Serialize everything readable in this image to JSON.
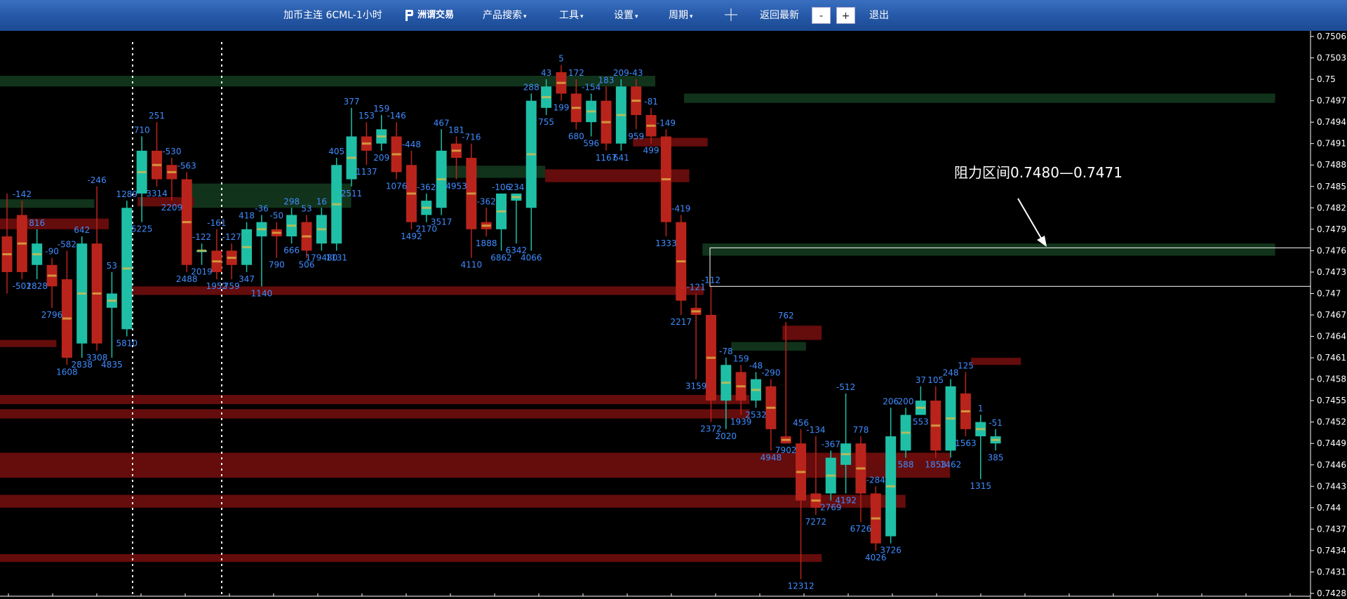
{
  "toolbar": {
    "title": "加币主连 6CML-1小时",
    "logo_text": "洲谓交易",
    "menu_search": "产品搜索",
    "menu_tools": "工具",
    "menu_settings": "设置",
    "menu_period": "周期",
    "back_latest": "返回最新",
    "zoom_out": "-",
    "zoom_in": "+",
    "exit": "退出",
    "caret": "▾",
    "crosshair_icon": "crosshair-icon"
  },
  "colors": {
    "background": "#000000",
    "toolbar": "#2a5fb0",
    "bull": "#1fbfa6",
    "bear": "#b8241b",
    "zone_red": "#6a0d0d",
    "zone_green": "#12361c",
    "label": "#3f8cff",
    "axis_text": "#ffffff"
  },
  "chart_data": {
    "type": "candlestick",
    "y_axis": {
      "position": "right",
      "min": 0.7428,
      "max": 0.7506,
      "tick_labels": [
        "0.7506",
        "0.7503",
        "0.75",
        "0.7497",
        "0.7494",
        "0.7491",
        "0.7488",
        "0.7485",
        "0.7482",
        "0.7479",
        "0.7476",
        "0.7473",
        "0.747",
        "0.7467",
        "0.7464",
        "0.7461",
        "0.7458",
        "0.7455",
        "0.7452",
        "0.7449",
        "0.7446",
        "0.7443",
        "0.744",
        "0.7437",
        "0.7434",
        "0.7431",
        "0.7428"
      ]
    },
    "annotation": {
      "text": "阻力区间0.7480—0.7471",
      "box_top": 0.74764,
      "box_bottom": 0.7471
    },
    "zones": [
      {
        "kind": "green",
        "top": 0.75005,
        "bottom": 0.7499,
        "x0": 0.0,
        "x1": 0.5
      },
      {
        "kind": "green",
        "top": 0.7498,
        "bottom": 0.74967,
        "x0": 0.522,
        "x1": 0.973
      },
      {
        "kind": "green",
        "top": 0.74832,
        "bottom": 0.7482,
        "x0": 0.0,
        "x1": 0.072
      },
      {
        "kind": "green",
        "top": 0.74854,
        "bottom": 0.7482,
        "x0": 0.143,
        "x1": 0.268
      },
      {
        "kind": "green",
        "top": 0.74879,
        "bottom": 0.74862,
        "x0": 0.337,
        "x1": 0.416
      },
      {
        "kind": "green",
        "top": 0.7477,
        "bottom": 0.74753,
        "x0": 0.536,
        "x1": 0.973
      },
      {
        "kind": "green",
        "top": 0.74632,
        "bottom": 0.7462,
        "x0": 0.558,
        "x1": 0.615
      },
      {
        "kind": "red",
        "top": 0.74805,
        "bottom": 0.7479,
        "x0": 0.0,
        "x1": 0.083
      },
      {
        "kind": "red",
        "top": 0.74835,
        "bottom": 0.74822,
        "x0": 0.105,
        "x1": 0.148
      },
      {
        "kind": "red",
        "top": 0.74874,
        "bottom": 0.74856,
        "x0": 0.416,
        "x1": 0.526
      },
      {
        "kind": "red",
        "top": 0.74918,
        "bottom": 0.74906,
        "x0": 0.483,
        "x1": 0.54
      },
      {
        "kind": "red",
        "top": 0.7471,
        "bottom": 0.74698,
        "x0": 0.094,
        "x1": 0.537
      },
      {
        "kind": "red",
        "top": 0.74635,
        "bottom": 0.74625,
        "x0": 0.0,
        "x1": 0.043
      },
      {
        "kind": "red",
        "top": 0.74655,
        "bottom": 0.74635,
        "x0": 0.597,
        "x1": 0.627
      },
      {
        "kind": "red",
        "top": 0.7461,
        "bottom": 0.746,
        "x0": 0.741,
        "x1": 0.779
      },
      {
        "kind": "red",
        "top": 0.74558,
        "bottom": 0.74545,
        "x0": 0.0,
        "x1": 0.572
      },
      {
        "kind": "red",
        "top": 0.74538,
        "bottom": 0.74525,
        "x0": 0.0,
        "x1": 0.572
      },
      {
        "kind": "red",
        "top": 0.74477,
        "bottom": 0.74442,
        "x0": 0.0,
        "x1": 0.725
      },
      {
        "kind": "red",
        "top": 0.74418,
        "bottom": 0.744,
        "x0": 0.0,
        "x1": 0.691
      },
      {
        "kind": "red",
        "top": 0.74477,
        "bottom": 0.74465,
        "x0": 0.64,
        "x1": 0.725
      },
      {
        "kind": "red",
        "top": 0.74335,
        "bottom": 0.74324,
        "x0": 0.0,
        "x1": 0.627
      }
    ],
    "candles": [
      {
        "o": 0.7478,
        "c": 0.7473,
        "h": 0.7484,
        "l": 0.747,
        "above": "",
        "below": ""
      },
      {
        "o": 0.7481,
        "c": 0.7473,
        "h": 0.7483,
        "l": 0.7472,
        "above": "-142",
        "below": "-502"
      },
      {
        "o": 0.7474,
        "c": 0.7477,
        "h": 0.7479,
        "l": 0.7472,
        "above": "816",
        "below": "1828"
      },
      {
        "o": 0.7474,
        "c": 0.7471,
        "h": 0.7475,
        "l": 0.7468,
        "above": "-90",
        "below": "2796"
      },
      {
        "o": 0.7472,
        "c": 0.7461,
        "h": 0.7476,
        "l": 0.746,
        "above": "-582",
        "below": "1608"
      },
      {
        "o": 0.7463,
        "c": 0.7477,
        "h": 0.7478,
        "l": 0.7461,
        "above": "642",
        "below": "2838"
      },
      {
        "o": 0.7477,
        "c": 0.7463,
        "h": 0.7485,
        "l": 0.7462,
        "above": "-246",
        "below": "3308"
      },
      {
        "o": 0.7468,
        "c": 0.747,
        "h": 0.7473,
        "l": 0.7461,
        "above": "53",
        "below": "4835"
      },
      {
        "o": 0.7465,
        "c": 0.7482,
        "h": 0.7483,
        "l": 0.7464,
        "above": "1289",
        "below": "5810"
      },
      {
        "o": 0.7484,
        "c": 0.749,
        "h": 0.7492,
        "l": 0.748,
        "above": "710",
        "below": "5225"
      },
      {
        "o": 0.749,
        "c": 0.7486,
        "h": 0.7494,
        "l": 0.7485,
        "above": "251",
        "below": "3314"
      },
      {
        "o": 0.7488,
        "c": 0.7486,
        "h": 0.7489,
        "l": 0.7483,
        "above": "-530",
        "below": "2209"
      },
      {
        "o": 0.7486,
        "c": 0.7474,
        "h": 0.7487,
        "l": 0.7473,
        "above": "-563",
        "below": "2488"
      },
      {
        "o": 0.7476,
        "c": 0.7476,
        "h": 0.7477,
        "l": 0.7474,
        "above": "-122",
        "below": "2019"
      },
      {
        "o": 0.7476,
        "c": 0.7473,
        "h": 0.7479,
        "l": 0.7472,
        "above": "-161",
        "below": "1952"
      },
      {
        "o": 0.7476,
        "c": 0.7474,
        "h": 0.7477,
        "l": 0.7472,
        "above": "-127",
        "below": "759"
      },
      {
        "o": 0.7474,
        "c": 0.7479,
        "h": 0.748,
        "l": 0.7473,
        "above": "418",
        "below": "347"
      },
      {
        "o": 0.7478,
        "c": 0.748,
        "h": 0.7481,
        "l": 0.7471,
        "above": "-36",
        "below": "1140"
      },
      {
        "o": 0.7479,
        "c": 0.7478,
        "h": 0.748,
        "l": 0.7475,
        "above": "-50",
        "below": "790"
      },
      {
        "o": 0.7478,
        "c": 0.7481,
        "h": 0.7482,
        "l": 0.7477,
        "above": "298",
        "below": "666"
      },
      {
        "o": 0.748,
        "c": 0.7476,
        "h": 0.7481,
        "l": 0.7475,
        "above": "53",
        "below": "506"
      },
      {
        "o": 0.7477,
        "c": 0.7481,
        "h": 0.7482,
        "l": 0.7476,
        "above": "16",
        "below": "179480"
      },
      {
        "o": 0.7477,
        "c": 0.7488,
        "h": 0.7489,
        "l": 0.7476,
        "above": "405",
        "below": "1131"
      },
      {
        "o": 0.7486,
        "c": 0.7492,
        "h": 0.7496,
        "l": 0.7485,
        "above": "377",
        "below": "2511"
      },
      {
        "o": 0.7492,
        "c": 0.749,
        "h": 0.7494,
        "l": 0.7488,
        "above": "153",
        "below": "1137"
      },
      {
        "o": 0.7491,
        "c": 0.7493,
        "h": 0.7495,
        "l": 0.749,
        "above": "159",
        "below": "209"
      },
      {
        "o": 0.7492,
        "c": 0.7487,
        "h": 0.7494,
        "l": 0.7486,
        "above": "-146",
        "below": "1076"
      },
      {
        "o": 0.7488,
        "c": 0.748,
        "h": 0.749,
        "l": 0.7479,
        "above": "-448",
        "below": "1492"
      },
      {
        "o": 0.7481,
        "c": 0.7483,
        "h": 0.7484,
        "l": 0.748,
        "above": "-362",
        "below": "2170"
      },
      {
        "o": 0.7482,
        "c": 0.749,
        "h": 0.7493,
        "l": 0.7481,
        "above": "467",
        "below": "3517"
      },
      {
        "o": 0.7491,
        "c": 0.7489,
        "h": 0.7492,
        "l": 0.7486,
        "above": "181",
        "below": "4953"
      },
      {
        "o": 0.7489,
        "c": 0.7479,
        "h": 0.7491,
        "l": 0.7475,
        "above": "-716",
        "below": "4110"
      },
      {
        "o": 0.748,
        "c": 0.7479,
        "h": 0.7482,
        "l": 0.7478,
        "above": "-362",
        "below": "1888"
      },
      {
        "o": 0.7479,
        "c": 0.7484,
        "h": 0.7484,
        "l": 0.7476,
        "above": "-106",
        "below": "6862"
      },
      {
        "o": 0.7483,
        "c": 0.7484,
        "h": 0.7484,
        "l": 0.7477,
        "above": "234",
        "below": "6342"
      },
      {
        "o": 0.7482,
        "c": 0.7497,
        "h": 0.7498,
        "l": 0.7476,
        "above": "288",
        "below": "4066"
      },
      {
        "o": 0.7496,
        "c": 0.7499,
        "h": 0.75,
        "l": 0.7495,
        "above": "43",
        "below": "755"
      },
      {
        "o": 0.7501,
        "c": 0.7498,
        "h": 0.7502,
        "l": 0.7497,
        "above": "5",
        "below": "199"
      },
      {
        "o": 0.7498,
        "c": 0.7494,
        "h": 0.75,
        "l": 0.7493,
        "above": "172",
        "below": "680"
      },
      {
        "o": 0.7494,
        "c": 0.7497,
        "h": 0.7498,
        "l": 0.7492,
        "above": "-154",
        "below": "596"
      },
      {
        "o": 0.7497,
        "c": 0.7491,
        "h": 0.7499,
        "l": 0.749,
        "above": "183",
        "below": "1167"
      },
      {
        "o": 0.7491,
        "c": 0.7499,
        "h": 0.75,
        "l": 0.749,
        "above": "209",
        "below": "641"
      },
      {
        "o": 0.7499,
        "c": 0.7495,
        "h": 0.75,
        "l": 0.7493,
        "above": "-43",
        "below": "959"
      },
      {
        "o": 0.7495,
        "c": 0.7492,
        "h": 0.7496,
        "l": 0.7491,
        "above": "-81",
        "below": "499"
      },
      {
        "o": 0.7492,
        "c": 0.748,
        "h": 0.7493,
        "l": 0.7478,
        "above": "-149",
        "below": "1333"
      },
      {
        "o": 0.748,
        "c": 0.7469,
        "h": 0.7481,
        "l": 0.7467,
        "above": "-419",
        "below": "2217"
      },
      {
        "o": 0.7468,
        "c": 0.7467,
        "h": 0.747,
        "l": 0.7458,
        "above": "-121",
        "below": "3159"
      },
      {
        "o": 0.7467,
        "c": 0.7455,
        "h": 0.7471,
        "l": 0.7452,
        "above": "-112",
        "below": "2372"
      },
      {
        "o": 0.7455,
        "c": 0.746,
        "h": 0.7461,
        "l": 0.7451,
        "above": "-78",
        "below": "2020"
      },
      {
        "o": 0.7459,
        "c": 0.7455,
        "h": 0.746,
        "l": 0.7453,
        "above": "159",
        "below": "1939"
      },
      {
        "o": 0.7455,
        "c": 0.7458,
        "h": 0.7459,
        "l": 0.7454,
        "above": "-48",
        "below": "2532"
      },
      {
        "o": 0.7457,
        "c": 0.7451,
        "h": 0.7458,
        "l": 0.7448,
        "above": "-290",
        "below": "4948"
      },
      {
        "o": 0.745,
        "c": 0.7449,
        "h": 0.7466,
        "l": 0.7449,
        "above": "762",
        "below": "7902"
      },
      {
        "o": 0.7449,
        "c": 0.7441,
        "h": 0.7451,
        "l": 0.743,
        "above": "456",
        "below": "12312"
      },
      {
        "o": 0.7442,
        "c": 0.744,
        "h": 0.745,
        "l": 0.7439,
        "above": "-134",
        "below": "7272"
      },
      {
        "o": 0.7442,
        "c": 0.7447,
        "h": 0.7448,
        "l": 0.7441,
        "above": "-367",
        "below": "2769"
      },
      {
        "o": 0.7446,
        "c": 0.7449,
        "h": 0.7456,
        "l": 0.7442,
        "above": "-512",
        "below": "4192"
      },
      {
        "o": 0.7449,
        "c": 0.7442,
        "h": 0.745,
        "l": 0.7438,
        "above": "778",
        "below": "6726"
      },
      {
        "o": 0.7442,
        "c": 0.7435,
        "h": 0.7443,
        "l": 0.7434,
        "above": "-284",
        "below": "4026"
      },
      {
        "o": 0.7436,
        "c": 0.745,
        "h": 0.7454,
        "l": 0.7435,
        "above": "206",
        "below": "3726"
      },
      {
        "o": 0.7448,
        "c": 0.7453,
        "h": 0.7454,
        "l": 0.7447,
        "above": "200",
        "below": "588"
      },
      {
        "o": 0.7453,
        "c": 0.7455,
        "h": 0.7457,
        "l": 0.7453,
        "above": "37",
        "below": "553"
      },
      {
        "o": 0.7455,
        "c": 0.7448,
        "h": 0.7457,
        "l": 0.7447,
        "above": "105",
        "below": "1853"
      },
      {
        "o": 0.7448,
        "c": 0.7457,
        "h": 0.7458,
        "l": 0.7447,
        "above": "248",
        "below": "1462"
      },
      {
        "o": 0.7456,
        "c": 0.7451,
        "h": 0.7459,
        "l": 0.745,
        "above": "125",
        "below": "1563"
      },
      {
        "o": 0.745,
        "c": 0.7452,
        "h": 0.7453,
        "l": 0.7444,
        "above": "1",
        "below": "1315"
      },
      {
        "o": 0.7449,
        "c": 0.745,
        "h": 0.7451,
        "l": 0.7448,
        "above": "-51",
        "below": "385"
      }
    ]
  }
}
